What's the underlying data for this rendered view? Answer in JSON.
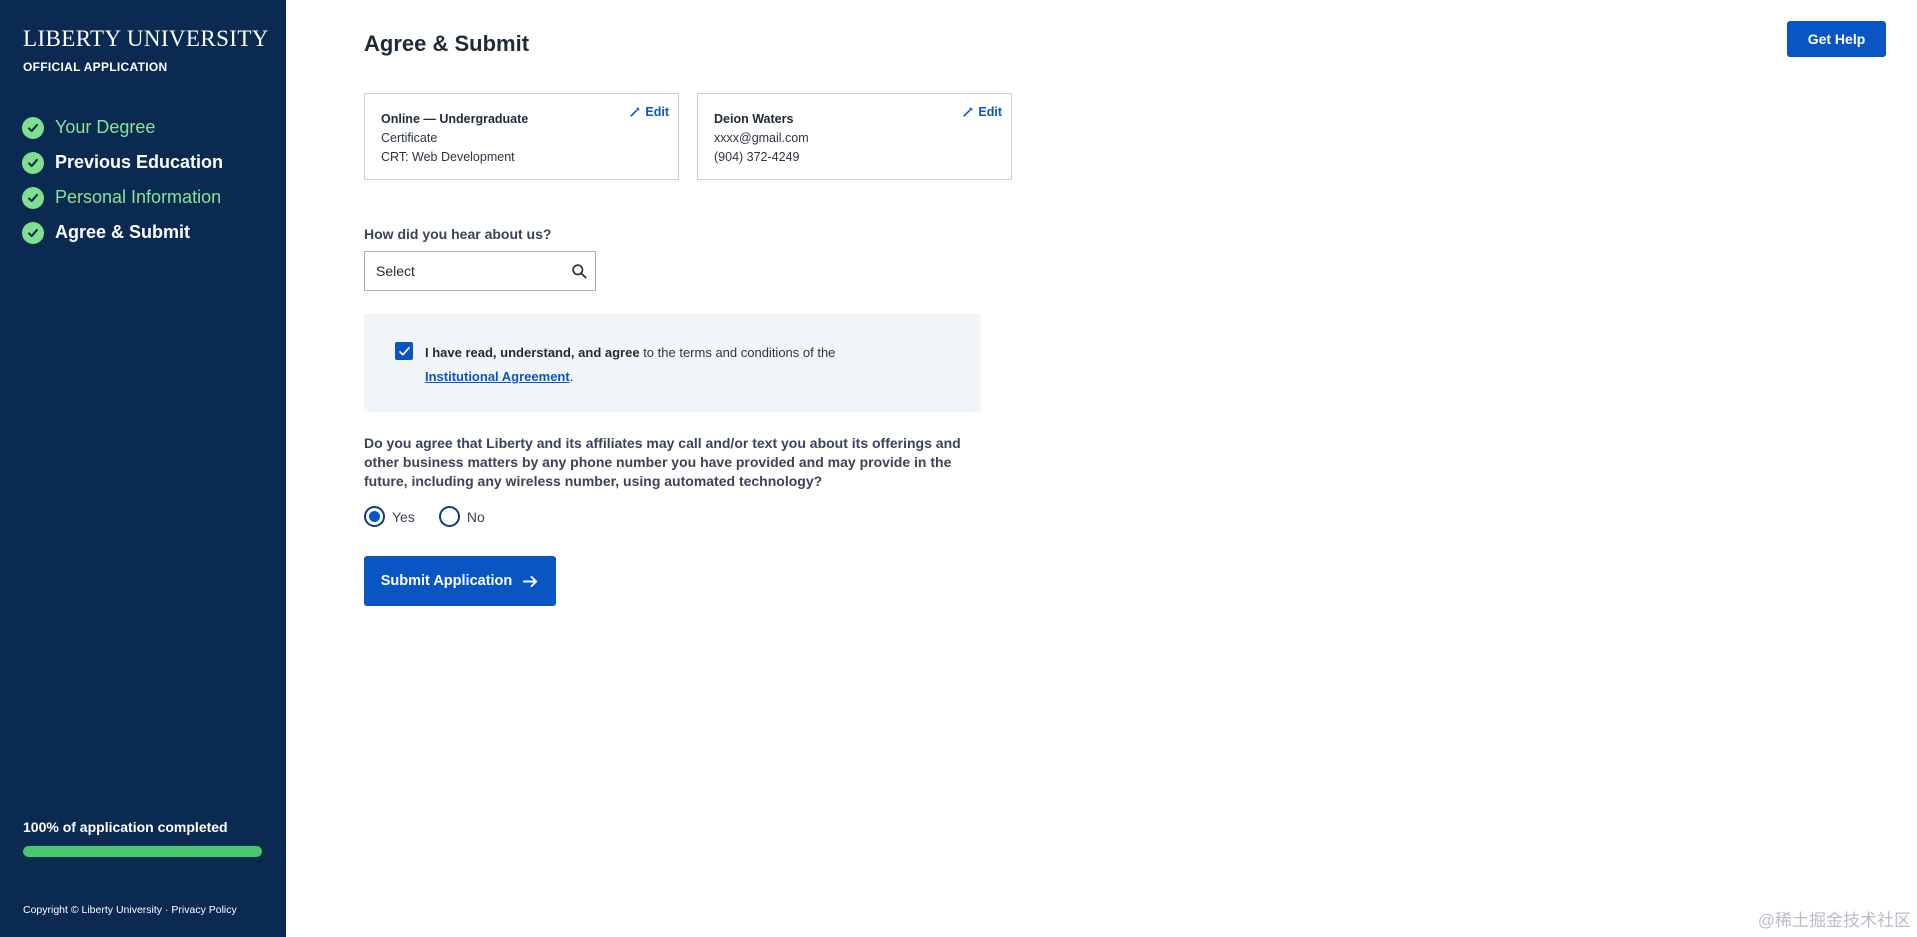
{
  "sidebar": {
    "brand_title": "LIBERTY UNIVERSITY",
    "brand_subtitle": "OFFICIAL APPLICATION",
    "steps": [
      {
        "label": "Your Degree",
        "status": "complete"
      },
      {
        "label": "Previous Education",
        "status": "complete"
      },
      {
        "label": "Personal Information",
        "status": "complete"
      },
      {
        "label": "Agree & Submit",
        "status": "complete"
      }
    ],
    "progress_text": "100% of application completed",
    "progress_percent": 100,
    "footer_copyright": "Copyright © Liberty University",
    "footer_separator": " · ",
    "footer_privacy": "Privacy Policy"
  },
  "header": {
    "title": "Agree & Submit",
    "help_label": "Get Help"
  },
  "summary_cards": [
    {
      "lines": [
        "Online — Undergraduate",
        "Certificate",
        "CRT: Web Development"
      ],
      "edit_label": "Edit"
    },
    {
      "lines": [
        "Deion Waters",
        "xxxx@gmail.com",
        "(904) 372-4249"
      ],
      "edit_label": "Edit"
    }
  ],
  "referral": {
    "label": "How did you hear about us?",
    "placeholder": "Select",
    "value": ""
  },
  "agreement": {
    "checked": true,
    "bold_text": "I have read, understand, and agree",
    "text": " to the terms and conditions of the",
    "link_text": "Institutional Agreement",
    "end": "."
  },
  "consent": {
    "question": "Do you agree that Liberty and its affiliates may call and/or text you about its offerings and other business matters by any phone number you have provided and may provide in the future, including any wireless number, using automated technology?",
    "options": [
      {
        "label": "Yes",
        "selected": true
      },
      {
        "label": "No",
        "selected": false
      }
    ]
  },
  "submit_label": "Submit Application",
  "watermark": "@稀土掘金技术社区",
  "colors": {
    "sidebar_bg": "#0b2a52",
    "accent": "#0a55c4",
    "step_complete": "#86e596",
    "progress": "#46c96a"
  }
}
